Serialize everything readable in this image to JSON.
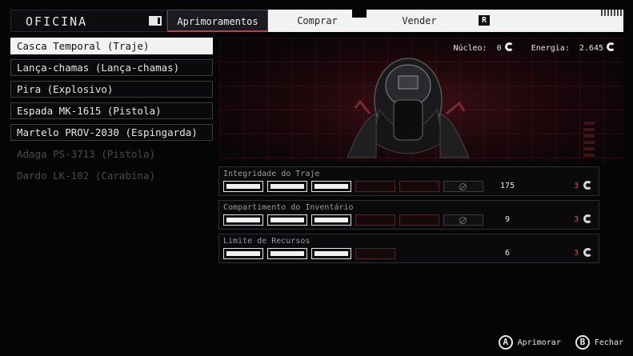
{
  "header": {
    "title": "OFICINA",
    "tabs": [
      {
        "label": "Aprimoramentos",
        "active": true
      },
      {
        "label": "Comprar",
        "active": false
      },
      {
        "label": "Vender",
        "active": false
      }
    ],
    "right_button": "R"
  },
  "items": [
    {
      "label": "Casca Temporal (Traje)",
      "state": "selected"
    },
    {
      "label": "Lança-chamas (Lança-chamas)",
      "state": "normal"
    },
    {
      "label": "Pira (Explosivo)",
      "state": "normal"
    },
    {
      "label": "Espada MK-1615 (Pistola)",
      "state": "normal"
    },
    {
      "label": "Martelo PROV-2030 (Espingarda)",
      "state": "normal"
    },
    {
      "label": "Adaga PS-3713 (Pistola)",
      "state": "disabled"
    },
    {
      "label": "Dardo LK-102 (Carabina)",
      "state": "disabled"
    }
  ],
  "resources": {
    "nucleo_label": "Núcleo:",
    "nucleo_value": "0",
    "energia_label": "Energia:",
    "energia_value": "2.645"
  },
  "upgrades": [
    {
      "title": "Integridade do Traje",
      "filled": 3,
      "empty": 2,
      "locked": 1,
      "value": "175",
      "cost": "3"
    },
    {
      "title": "Compartimento do Inventário",
      "filled": 3,
      "empty": 2,
      "locked": 1,
      "value": "9",
      "cost": "3"
    },
    {
      "title": "Limite de Recursos",
      "filled": 3,
      "empty": 1,
      "locked": 0,
      "value": "6",
      "cost": "3"
    }
  ],
  "footer": {
    "a_key": "A",
    "a_label": "Aprimorar",
    "b_key": "B",
    "b_label": "Fechar"
  },
  "colors": {
    "accent": "#c23b45",
    "cost": "#d04a55"
  }
}
